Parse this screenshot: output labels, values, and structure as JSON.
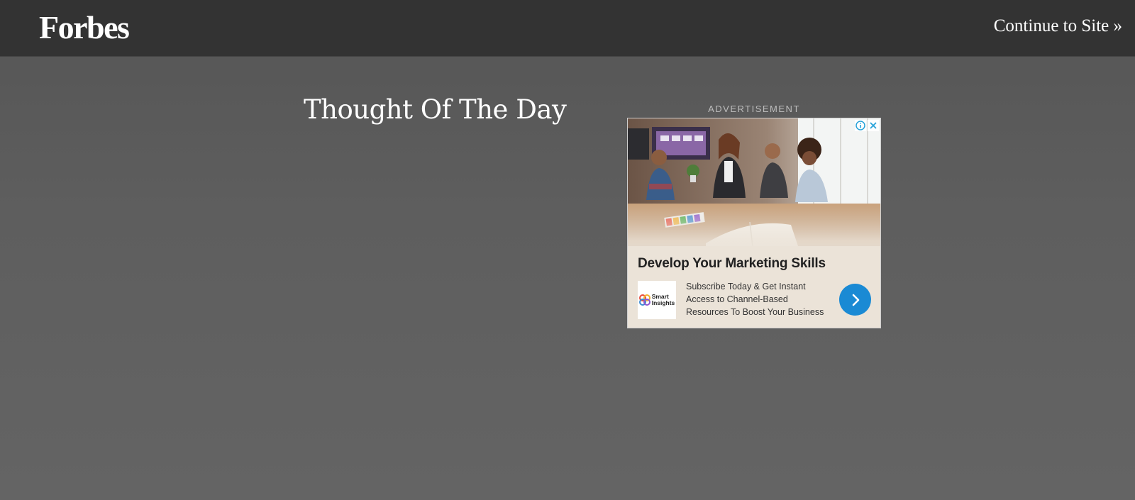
{
  "header": {
    "logo": "Forbes",
    "continue_link": "Continue to Site »"
  },
  "main": {
    "title": "Thought Of The Day"
  },
  "ad": {
    "label": "ADVERTISEMENT",
    "headline": "Develop Your Marketing Skills",
    "advertiser_logo_text": [
      "Smart",
      "Insights"
    ],
    "body_lines": [
      "Subscribe Today & Get Instant",
      "Access to Channel-Based",
      "Resources To Boost Your Business"
    ],
    "controls": {
      "info_icon": "info-icon",
      "close_icon": "close-icon"
    },
    "cta_icon": "chevron-right-icon",
    "colors": {
      "cta": "#1a8ad4",
      "controls": "#29a3d9"
    }
  },
  "colors": {
    "header_bg": "#333333",
    "page_bg": "#5e5e5e",
    "ad_bg": "#ebe3d8"
  }
}
